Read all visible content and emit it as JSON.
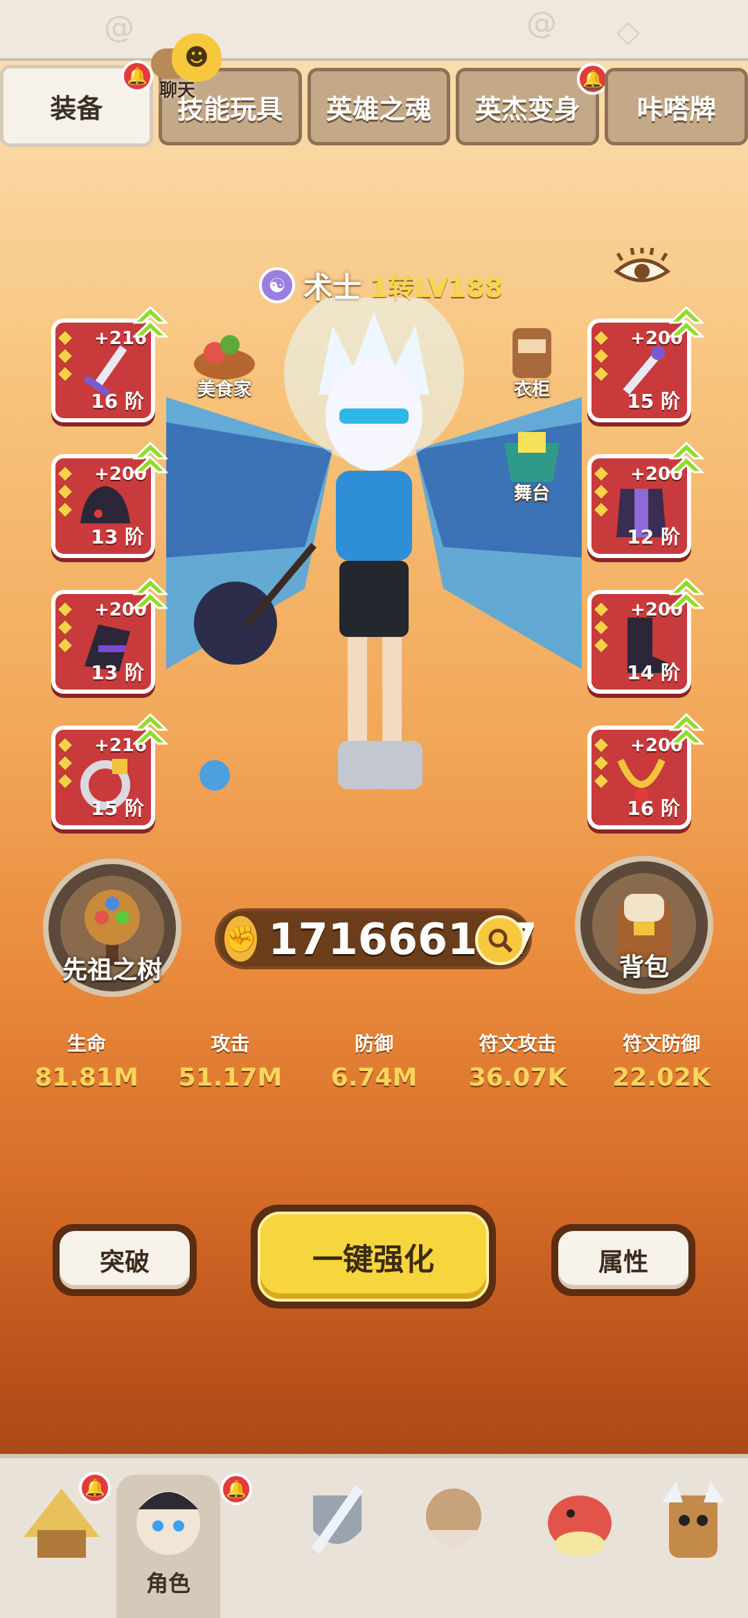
{
  "tabs": [
    {
      "label": "装备",
      "active": true,
      "notify": true
    },
    {
      "label": "技能玩具",
      "active": false,
      "notify": false
    },
    {
      "label": "英雄之魂",
      "active": false,
      "notify": false
    },
    {
      "label": "英杰变身",
      "active": false,
      "notify": true
    },
    {
      "label": "咔嗒牌",
      "active": false,
      "notify": false
    }
  ],
  "chat": {
    "label": "聊天"
  },
  "hero": {
    "class_name": "术士",
    "level": "1转LV188"
  },
  "left_slots": [
    {
      "plus": "+216",
      "tier": "16 阶"
    },
    {
      "plus": "+200",
      "tier": "13 阶"
    },
    {
      "plus": "+200",
      "tier": "13 阶"
    },
    {
      "plus": "+216",
      "tier": "15 阶"
    }
  ],
  "right_slots": [
    {
      "plus": "+200",
      "tier": "15 阶"
    },
    {
      "plus": "+200",
      "tier": "12 阶"
    },
    {
      "plus": "+200",
      "tier": "14 阶"
    },
    {
      "plus": "+200",
      "tier": "16 阶"
    }
  ],
  "mini": {
    "food": "美食家",
    "wardrobe": "衣柜",
    "stage": "舞台"
  },
  "ancestor_tree": "先祖之树",
  "backpack": "背包",
  "power": "171666107",
  "stats": [
    {
      "name": "生命",
      "value": "81.81M"
    },
    {
      "name": "攻击",
      "value": "51.17M"
    },
    {
      "name": "防御",
      "value": "6.74M"
    },
    {
      "name": "符文攻击",
      "value": "36.07K"
    },
    {
      "name": "符文防御",
      "value": "22.02K"
    }
  ],
  "buttons": {
    "breakthrough": "突破",
    "enhance_all": "一键强化",
    "attributes": "属性"
  },
  "bottom_nav": {
    "active_label": "角色"
  },
  "colors": {
    "slot_red": "#c93a3c",
    "gold": "#f7d64b",
    "primary_button": "#f6d53e"
  }
}
